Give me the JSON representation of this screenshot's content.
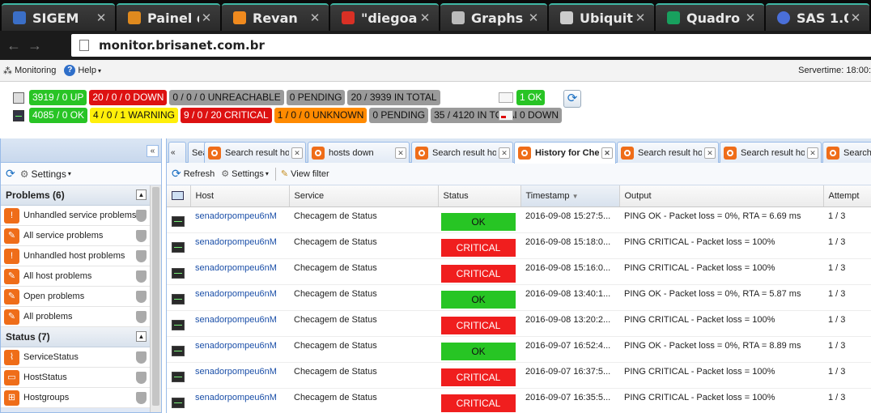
{
  "browser": {
    "tabs": [
      {
        "title": "SIGEM",
        "favicon_color": "#3b6fc7",
        "icon": "sigem-favicon"
      },
      {
        "title": "Painel d",
        "favicon_color": "#e08a1e",
        "icon": "painel-favicon"
      },
      {
        "title": "Revan",
        "favicon_color": "#f08a1e",
        "icon": "revan-favicon"
      },
      {
        "title": "\"diegoa",
        "favicon_color": "#d93025",
        "icon": "gmail-favicon"
      },
      {
        "title": "Graphs",
        "favicon_color": "#bbbbbb",
        "icon": "page-favicon"
      },
      {
        "title": "Ubiquiti",
        "favicon_color": "#cccccc",
        "icon": "ubiquiti-favicon"
      },
      {
        "title": "Quadro",
        "favicon_color": "#18a05e",
        "icon": "sheets-favicon"
      },
      {
        "title": "SAS 1.0",
        "favicon_color": "#4a6fd8",
        "icon": "sas-favicon"
      }
    ],
    "url": "monitor.brisanet.com.br"
  },
  "menubar": {
    "monitoring_label": "Monitoring",
    "help_label": "Help",
    "servertime": "Servertime: 18:00:"
  },
  "summary": {
    "hosts": [
      "3919 / 0 UP",
      "20 / 0 / 0 DOWN",
      "0 / 0 / 0 UNREACHABLE",
      "0 PENDING",
      "20 / 3939 IN TOTAL"
    ],
    "services": [
      "4085 / 0 OK",
      "4 / 0 / 1 WARNING",
      "9 / 0 / 20 CRITICAL",
      "1 / 0 / 0 UNKNOWN",
      "0 PENDING",
      "35 / 4120 IN TOTAL"
    ],
    "extra_top": "1 OK",
    "extra_bottom": "0 DOWN"
  },
  "sidebar": {
    "settings_label": "Settings",
    "groups": [
      {
        "title": "Problems (6)",
        "items": [
          {
            "label": "Unhandled service problems"
          },
          {
            "label": "All service problems"
          },
          {
            "label": "Unhandled host problems"
          },
          {
            "label": "All host problems"
          },
          {
            "label": "Open problems"
          },
          {
            "label": "All problems"
          }
        ]
      },
      {
        "title": "Status (7)",
        "items": [
          {
            "label": "ServiceStatus"
          },
          {
            "label": "HostStatus"
          },
          {
            "label": "Hostgroups"
          }
        ]
      }
    ]
  },
  "main": {
    "tabs": [
      {
        "title": "Search result ho"
      },
      {
        "title": "hosts down"
      },
      {
        "title": "Search result ho"
      },
      {
        "title": "History for Che"
      },
      {
        "title": "Search result ho"
      },
      {
        "title": "Search result ho"
      },
      {
        "title": "Search"
      }
    ],
    "toolbar": {
      "refresh_label": "Refresh",
      "settings_label": "Settings",
      "view_filter_label": "View filter"
    },
    "columns": [
      "Host",
      "Service",
      "Status",
      "Timestamp",
      "Output",
      "Attempt"
    ],
    "rows": [
      {
        "host": "senadorpompeu6nM",
        "service": "Checagem de Status",
        "status": "OK",
        "timestamp": "2016-09-08 15:27:5...",
        "output": "PING OK - Packet loss = 0%, RTA = 6.69 ms",
        "attempt": "1 / 3"
      },
      {
        "host": "senadorpompeu6nM",
        "service": "Checagem de Status",
        "status": "CRITICAL",
        "timestamp": "2016-09-08 15:18:0...",
        "output": "PING CRITICAL - Packet loss = 100%",
        "attempt": "1 / 3"
      },
      {
        "host": "senadorpompeu6nM",
        "service": "Checagem de Status",
        "status": "CRITICAL",
        "timestamp": "2016-09-08 15:16:0...",
        "output": "PING CRITICAL - Packet loss = 100%",
        "attempt": "1 / 3"
      },
      {
        "host": "senadorpompeu6nM",
        "service": "Checagem de Status",
        "status": "OK",
        "timestamp": "2016-09-08 13:40:1...",
        "output": "PING OK - Packet loss = 0%, RTA = 5.87 ms",
        "attempt": "1 / 3"
      },
      {
        "host": "senadorpompeu6nM",
        "service": "Checagem de Status",
        "status": "CRITICAL",
        "timestamp": "2016-09-08 13:20:2...",
        "output": "PING CRITICAL - Packet loss = 100%",
        "attempt": "1 / 3"
      },
      {
        "host": "senadorpompeu6nM",
        "service": "Checagem de Status",
        "status": "OK",
        "timestamp": "2016-09-07 16:52:4...",
        "output": "PING OK - Packet loss = 0%, RTA = 8.89 ms",
        "attempt": "1 / 3"
      },
      {
        "host": "senadorpompeu6nM",
        "service": "Checagem de Status",
        "status": "CRITICAL",
        "timestamp": "2016-09-07 16:37:5...",
        "output": "PING CRITICAL - Packet loss = 100%",
        "attempt": "1 / 3"
      },
      {
        "host": "senadorpompeu6nM",
        "service": "Checagem de Status",
        "status": "CRITICAL",
        "timestamp": "2016-09-07 16:35:5...",
        "output": "PING CRITICAL - Packet loss = 100%",
        "attempt": "1 / 3"
      }
    ]
  },
  "colors": {
    "ok": "#27c524",
    "critical": "#f01e1e",
    "warning": "#ffef0a",
    "unknown": "#ff8a00",
    "accent": "#ef6d19"
  }
}
